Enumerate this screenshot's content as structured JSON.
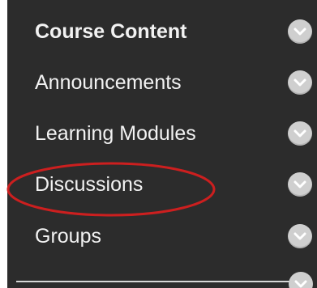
{
  "menu": {
    "items": [
      {
        "label": "Course Content",
        "bold": true
      },
      {
        "label": "Announcements",
        "bold": false
      },
      {
        "label": "Learning Modules",
        "bold": false
      },
      {
        "label": "Discussions",
        "bold": false
      },
      {
        "label": "Groups",
        "bold": false
      }
    ]
  },
  "annotation": {
    "highlighted_item": "Discussions",
    "color": "#cc1f1f"
  },
  "colors": {
    "panel_background": "#2c2c2c",
    "text": "#f2f2f2",
    "chevron_button": "#cfcfcf",
    "chevron_glyph": "#ffffff"
  },
  "icons": {
    "item_button": "chevron-down-icon"
  }
}
